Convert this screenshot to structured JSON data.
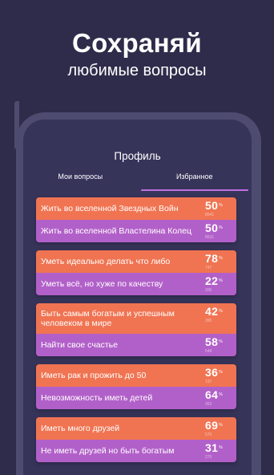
{
  "promo": {
    "title": "Сохраняй",
    "subtitle": "любимые вопросы"
  },
  "screen": {
    "title": "Профиль",
    "tabs": [
      {
        "label": "Мои вопросы",
        "active": false
      },
      {
        "label": "Избранное",
        "active": true
      }
    ]
  },
  "colors": {
    "background": "#2f2b4a",
    "option_a": "#f07452",
    "option_b": "#b260c9",
    "tab_underline": "#c16fe2"
  },
  "favorites": [
    {
      "a": {
        "text": "Жить во вселенной Звездных Войн",
        "percent": "50",
        "count": "8541"
      },
      "b": {
        "text": "Жить во вселенной Властелина Колец",
        "percent": "50",
        "count": "8531"
      }
    },
    {
      "a": {
        "text": "Уметь идеально делать что либо",
        "percent": "78",
        "count": "747"
      },
      "b": {
        "text": "Уметь всё, но хуже по качеству",
        "percent": "22",
        "count": "205"
      }
    },
    {
      "a": {
        "text": "Быть самым богатым и успешным человеком в мире",
        "percent": "42",
        "count": "395"
      },
      "b": {
        "text": "Найти свое счастье",
        "percent": "58",
        "count": "548"
      }
    },
    {
      "a": {
        "text": "Иметь рак и прожить до 50",
        "percent": "36",
        "count": "197"
      },
      "b": {
        "text": "Невозможность иметь детей",
        "percent": "64",
        "count": "352"
      }
    },
    {
      "a": {
        "text": "Иметь много друзей",
        "percent": "69",
        "count": "570"
      },
      "b": {
        "text": "Не иметь друзей но быть богатым",
        "percent": "31",
        "count": "275"
      }
    }
  ]
}
